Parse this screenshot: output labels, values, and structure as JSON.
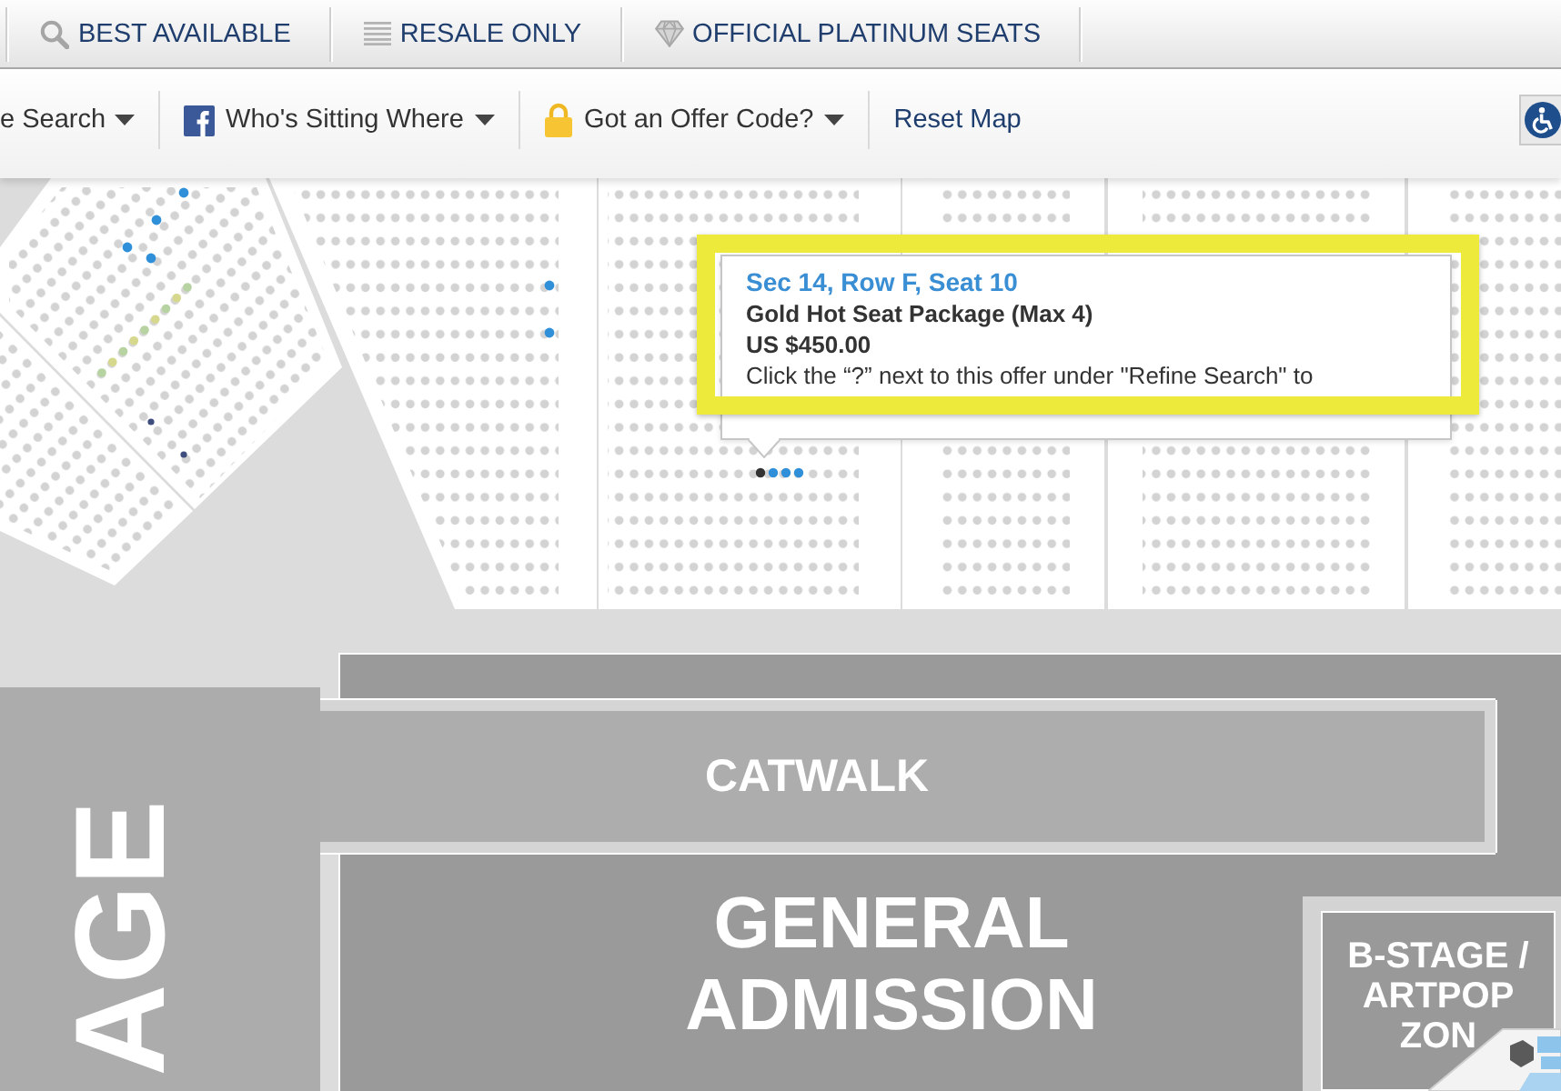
{
  "filter_tabs": [
    {
      "label": "BEST AVAILABLE"
    },
    {
      "label": "RESALE ONLY"
    },
    {
      "label": "OFFICIAL PLATINUM SEATS"
    }
  ],
  "toolbar": [
    {
      "kind": "dropdown",
      "label": "e Search"
    },
    {
      "kind": "dropdown",
      "label": "Who's Sitting Where"
    },
    {
      "kind": "dropdown",
      "label": "Got an Offer Code?"
    },
    {
      "kind": "link",
      "label": "Reset Map"
    }
  ],
  "seat_tooltip": {
    "seat": "Sec 14, Row F, Seat 10",
    "package": "Gold Hot Seat Package (Max 4)",
    "price": "US $450.00",
    "note": "Click the “?” next to this offer under \"Refine Search\" to"
  },
  "venue_areas": [
    {
      "kind": "stage",
      "label": "AGE"
    },
    {
      "kind": "catwalk",
      "label": "CATWALK"
    },
    {
      "kind": "floor",
      "label": "GENERAL ADMISSION"
    },
    {
      "kind": "bstage",
      "label": "B-STAGE / ARTPOP ZON"
    }
  ]
}
